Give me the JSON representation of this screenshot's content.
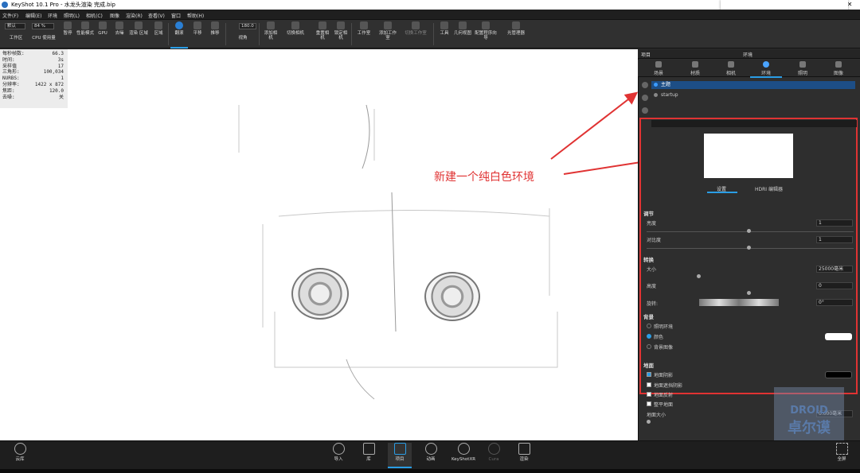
{
  "titlebar": {
    "title": "KeyShot 10.1 Pro  - 水龙头渲染 完成.bip",
    "controls": [
      "—",
      "□",
      "✕"
    ]
  },
  "menu": [
    "文件(F)",
    "编辑(E)",
    "环境",
    "照明(L)",
    "相机(C)",
    "图像",
    "渲染(R)",
    "查看(V)",
    "窗口",
    "帮助(H)"
  ],
  "toolbar": {
    "workspace_value": "默认",
    "cpu_value": "84 %",
    "items": [
      "工作区",
      "CPU 使用量",
      "暂停",
      "性能模式",
      "GPU",
      "去噪",
      "渲染 区域",
      "区域",
      "翻滚",
      "平移",
      "推移",
      "视角",
      "添加相机",
      "切换相机",
      "重置相机",
      "锁定相机",
      "工作室",
      "添加工作室",
      "切换工作室",
      "工具",
      "几何视图",
      "配置程序向导",
      "光管理器"
    ],
    "fov_value": "180.0"
  },
  "stats": [
    {
      "k": "每秒帧数:",
      "v": "66.3"
    },
    {
      "k": "时间:",
      "v": "3s"
    },
    {
      "k": "采样值",
      "v": "17"
    },
    {
      "k": "三角形:",
      "v": "100,034"
    },
    {
      "k": "NURBS:",
      "v": "1"
    },
    {
      "k": "分辨率:",
      "v": "1422 x 872"
    },
    {
      "k": "焦距:",
      "v": "120.0"
    },
    {
      "k": "去噪:",
      "v": "关"
    }
  ],
  "annotation": {
    "text": "新建一个纯白色环境",
    "color": "#e03333"
  },
  "side": {
    "header_left": "项目",
    "header_title": "环境",
    "tabs": [
      "场景",
      "材质",
      "相机",
      "环境",
      "照明",
      "图像"
    ],
    "active_tab": "环境",
    "envs": [
      "主题",
      "startup"
    ],
    "preview_tabs": [
      "设置",
      "HDRI 编辑器"
    ],
    "sections": {
      "adjust": "调节",
      "brightness": "亮度",
      "brightness_v": "1",
      "contrast": "对比度",
      "contrast_v": "1",
      "transform": "转换",
      "size": "大小",
      "size_v": "25000毫米",
      "height": "高度",
      "height_v": "0",
      "rotation": "旋转:",
      "rotation_v": "0°",
      "background": "背景",
      "bg_lighting": "照明环境",
      "bg_color": "颜色",
      "bg_image": "背景图像",
      "ground": "地面",
      "ground_shadow": "地面阴影",
      "ground_occlusion": "地面遮挡阴影",
      "ground_reflect": "地面反射",
      "flatten": "整平地面",
      "ground_size": "地面大小",
      "ground_size_v": "0.000毫米"
    },
    "colors": {
      "bg_swatch": "#ffffff",
      "shadow_swatch": "#000000",
      "accent": "#2a9de5"
    }
  },
  "bottom": {
    "left": "云库",
    "items": [
      "导入",
      "库",
      "项目",
      "动画",
      "KeyShotXR",
      "Cura",
      "渲染"
    ],
    "active": "项目",
    "right": "全屏"
  },
  "watermark": {
    "top": "DROID",
    "bottom": "卓尔谟"
  }
}
